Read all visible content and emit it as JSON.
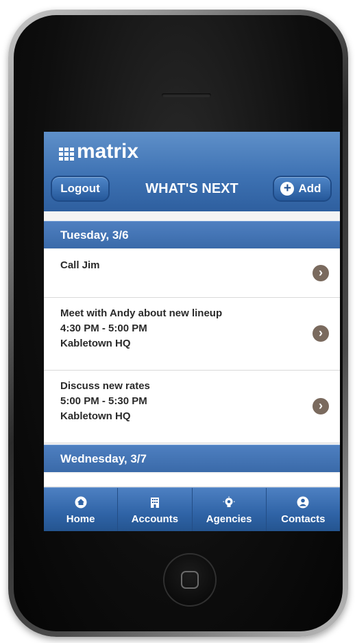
{
  "app": {
    "logo_text": "matrix",
    "page_title": "WHAT'S NEXT",
    "logout_label": "Logout",
    "add_label": "Add",
    "add_symbol": "+"
  },
  "days": [
    {
      "label": "Tuesday, 3/6",
      "items": [
        {
          "lines": [
            "Call Jim"
          ]
        },
        {
          "lines": [
            "Meet with Andy about new lineup",
            "4:30 PM - 5:00 PM",
            "Kabletown HQ"
          ]
        },
        {
          "lines": [
            "Discuss new rates",
            "5:00 PM - 5:30 PM",
            "Kabletown HQ"
          ]
        }
      ]
    },
    {
      "label": "Wednesday, 3/7",
      "items": []
    }
  ],
  "tabs": [
    {
      "label": "Home",
      "icon": "home-icon"
    },
    {
      "label": "Accounts",
      "icon": "building-icon"
    },
    {
      "label": "Agencies",
      "icon": "lightbulb-icon"
    },
    {
      "label": "Contacts",
      "icon": "person-icon"
    }
  ],
  "colors": {
    "header_blue": "#3e72b3",
    "day_header_blue": "#4e7fc0",
    "chevron_brown": "#7a6a5e",
    "tabbar_blue": "#2f63a6"
  }
}
